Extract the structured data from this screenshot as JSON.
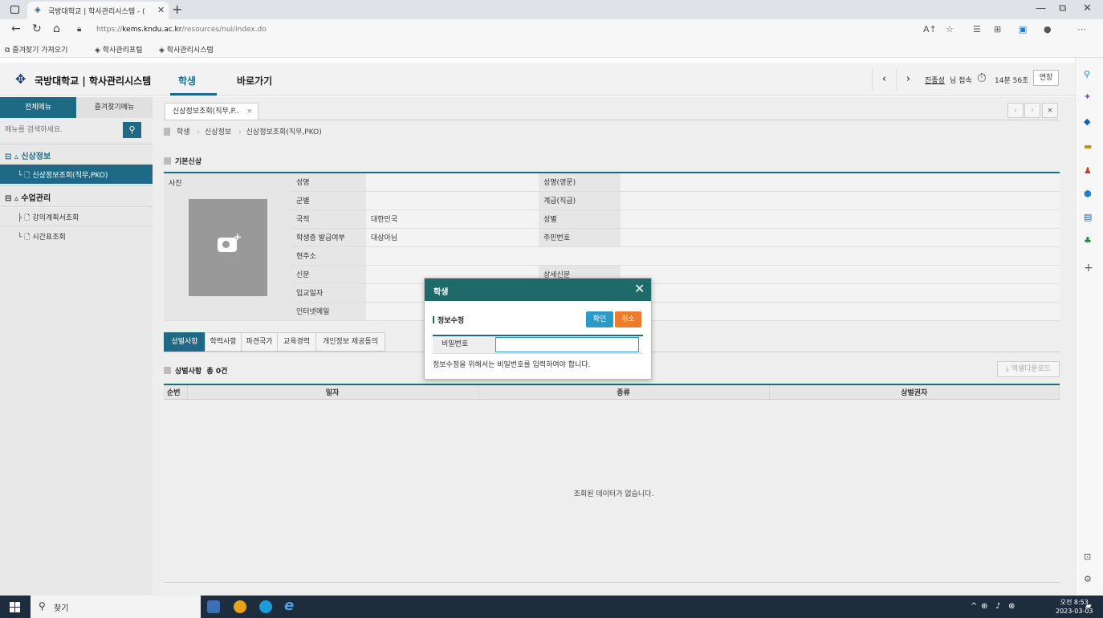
{
  "browser": {
    "tab_title": "국방대학교 | 학사관리시스템 - (",
    "url_prefix": "https://",
    "url_host": "kems.kndu.ac.kr",
    "url_path": "/resources/nui/index.do",
    "bookmarks": [
      "즐겨찾기 가져오기",
      "학사관리포털",
      "학사관리시스템"
    ]
  },
  "header": {
    "logo": "국방대학교 | 학사관리시스템",
    "menus": [
      "학생",
      "바로가기"
    ],
    "user": "진종성",
    "login_text": "님 접속",
    "timer": "14분 56초",
    "extend": "연장"
  },
  "sidebar": {
    "tabs": [
      "전체메뉴",
      "즐겨찾기메뉴"
    ],
    "search_placeholder": "메뉴를 검색하세요.",
    "items": [
      {
        "label": "⊟ ▵ 신상정보"
      },
      {
        "label": "└ 🗋 신상정보조회(직무,PKO)"
      },
      {
        "label": "⊟ ▵ 수업관리"
      },
      {
        "label": "├ 🗋 강의계획서조회"
      },
      {
        "label": "└ 🗋 시간표조회"
      }
    ]
  },
  "content": {
    "tab": "신상정보조회(직무,P..",
    "breadcrumb": [
      "학생",
      "신상정보",
      "신상정보조회(직무,PKO)"
    ],
    "section_basic": "기본신상",
    "photo_label": "사진",
    "fields": {
      "name": "성명",
      "name_en": "성명(영문)",
      "branch": "군별",
      "rank": "계급(직급)",
      "nationality": "국적",
      "nationality_val": "대한민국",
      "gender": "성별",
      "id_issue": "학생증 발급여부",
      "id_issue_val": "대상아님",
      "rrn": "주민번호",
      "address": "현주소",
      "status": "신분",
      "status_detail": "상세신분",
      "admission": "입교일자",
      "email": "인터넷메일"
    },
    "subtabs": [
      "상벌사항",
      "학력사항",
      "파견국가",
      "교육경력",
      "개인정보 제공동의"
    ],
    "reward_section": "상벌사항",
    "reward_count": "총 0건",
    "excel": "⤓ 엑셀다운로드",
    "columns": [
      "순번",
      "일자",
      "종류",
      "상벌권자"
    ],
    "empty": "조회된 데이터가 없습니다."
  },
  "modal": {
    "title": "학생",
    "subtitle": "정보수정",
    "ok": "확인",
    "cancel": "취소",
    "pw_label": "비밀번호",
    "msg": "정보수정을 위해서는 비밀번호를 입력하여야 합니다."
  },
  "taskbar": {
    "search": "찾기",
    "time": "오전 8:53",
    "date": "2023-03-03"
  }
}
